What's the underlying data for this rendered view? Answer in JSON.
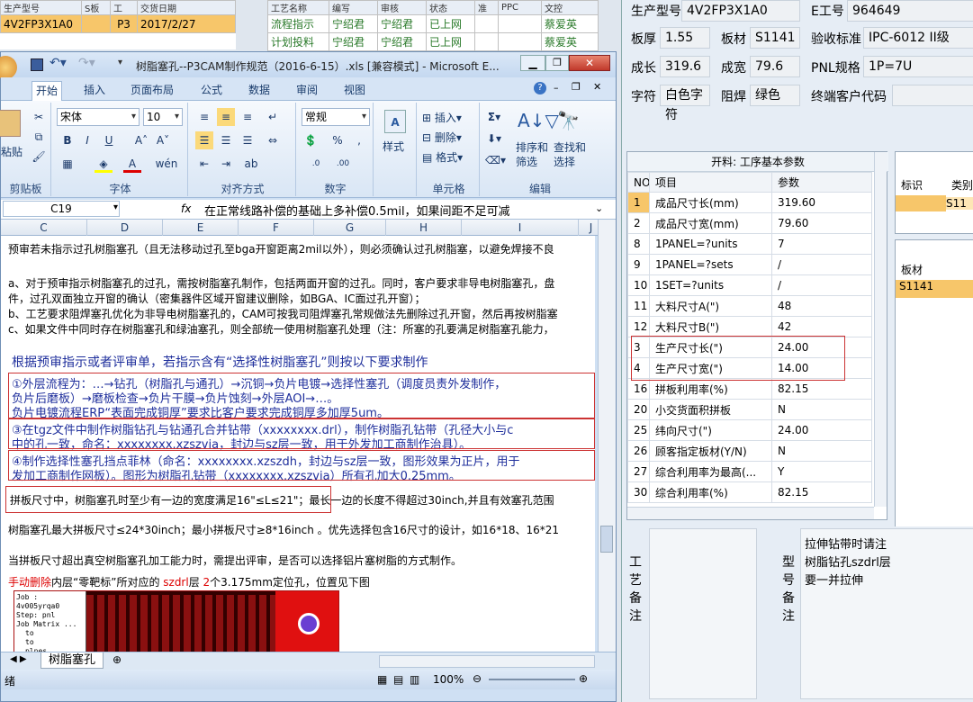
{
  "top_left_grid": {
    "headers": [
      "生产型号",
      "S板",
      "工",
      "交货日期"
    ],
    "row": [
      "4V2FP3X1A0",
      "",
      "P3",
      "2017/2/27"
    ]
  },
  "top_mid_grid": {
    "headers": [
      "工艺名称",
      "编写",
      "审核",
      "状态",
      "准",
      "PPC",
      "文控"
    ],
    "rows": [
      [
        "流程指示",
        "宁绍君",
        "宁绍君",
        "已上网",
        "",
        "",
        "蔡爱英"
      ],
      [
        "计划投料",
        "宁绍君",
        "宁绍君",
        "已上网",
        "",
        "",
        "蔡爱英"
      ]
    ]
  },
  "excel": {
    "title": "树脂塞孔--P3CAM制作规范（2016-6-15）.xls  [兼容模式] - Microsoft E...",
    "tabs": [
      "开始",
      "插入",
      "页面布局",
      "公式",
      "数据",
      "审阅",
      "视图"
    ],
    "groups": {
      "clipboard": "剪贴板",
      "font": "字体",
      "align": "对齐方式",
      "number": "数字",
      "cells": "单元格",
      "edit": "编辑",
      "styles": "样式"
    },
    "paste": "粘贴",
    "font_name": "宋体",
    "font_size": "10",
    "num_format": "常规",
    "cells_btns": [
      "插入",
      "删除",
      "格式"
    ],
    "sort": "排序和筛选",
    "find": "查找和选择",
    "style_btn": "样式",
    "name_box": "C19",
    "fx": "fx",
    "formula": "在正常线路补偿的基础上多补偿0.5mil，如果间距不足可减",
    "cols": [
      "C",
      "D",
      "E",
      "F",
      "G",
      "H",
      "I",
      "J"
    ],
    "lines": [
      "预审若未指示过孔树脂塞孔（且无法移动过孔至bga开窗距离2mil以外），则必须确认过孔树脂塞，以避免焊接不良",
      "a、对于预审指示树脂塞孔的过孔，需按树脂塞孔制作，包括两面开窗的过孔。同时，客户要求非导电树脂塞孔，盘",
      "件，过孔双面独立开窗的确认（密集器件区域开窗建议删除，如BGA、IC面过孔开窗）；",
      "b、工艺要求阻焊塞孔优化为非导电树脂塞孔的，CAM可按我司阻焊塞孔常规做法先删除过孔开窗，然后再按树脂塞",
      "c、如果文件中同时存在树脂塞孔和绿油塞孔，则全部统一使用树脂塞孔处理（注：所塞的孔要满足树脂塞孔能力，",
      "根据预审指示或者评审单，若指示含有“选择性树脂塞孔”则按以下要求制作",
      "①外层流程为：…→钻孔（树脂孔与通孔）→沉铜→负片电镀→选择性塞孔（调度员责外发制作，",
      "负片后磨板）→磨板检查→负片干膜→负片蚀刻→外层AOI→…。",
      "负片电镀流程ERP“表面完成铜厚”要求比客户要求完成铜厚多加厚5um。",
      "③在tgz文件中制作树脂钻孔与钻通孔合并钻带（xxxxxxxx.drl），制作树脂孔钻带（孔径大小与c",
      "中的孔一致，命名：xxxxxxxx.xzszvia，封边与sz层一致，用于外发加工商制作治具）。",
      "④制作选择性塞孔挡点菲林（命名：xxxxxxxx.xzszdh，封边与sz层一致，图形效果为正片，用于",
      "发加工商制作网板）。图形为树脂孔钻带（xxxxxxxx.xzszvia）所有孔加大0.25mm。",
      "拼板尺寸中，树脂塞孔时至少有一边的宽度满足16\"≤L≤21\"；最长一边的长度不得超过30inch,并且有效塞孔范围",
      "树脂塞孔最大拼板尺寸≤24*30inch；最小拼板尺寸≥8*16inch 。优先选择包含16尺寸的设计，如16*18、16*21",
      "当拼板尺寸超出真空树脂塞孔加工能力时，需提出评审，是否可以选择铝片塞树脂的方式制作。"
    ],
    "last_line": {
      "p1": "手动删除",
      "p2": "内层“零靶标”所对应的 ",
      "p3": "szdrl",
      "p4": "层 ",
      "p5": "2",
      "p6": "个3.175mm定位孔，位置见下图"
    },
    "mini": [
      "Job : 4v005yrqa0",
      "Step: pnl",
      "Job Matrix ...",
      "to",
      "to",
      "plnes"
    ],
    "sheet_tab": "树脂塞孔",
    "status": "绪",
    "zoom": "100%"
  },
  "right": {
    "model_label": "生产型号",
    "model": "4V2FP3X1A0",
    "eno_label": "E工号",
    "eno": "964649",
    "thick_label": "板厚",
    "thick": "1.55",
    "mat_label": "板材",
    "mat": "S1141",
    "std_label": "验收标准",
    "std": "IPC-6012 II级",
    "len_label": "成长",
    "len": "319.6",
    "wid_label": "成宽",
    "wid": "79.6",
    "pnl_label": "PNL规格",
    "pnl": "1P=7U",
    "char_label": "字符",
    "char": "白色字符",
    "mask_label": "阻焊",
    "mask": "绿色",
    "cust_label": "终端客户代码",
    "grid_title": "开料: 工序基本参数",
    "grid_headers": [
      "NO",
      "项目",
      "参数"
    ],
    "grid_rows": [
      [
        "1",
        "成品尺寸长(mm)",
        "319.60"
      ],
      [
        "2",
        "成品尺寸宽(mm)",
        "79.60"
      ],
      [
        "8",
        "1PANEL=?units",
        "7"
      ],
      [
        "9",
        "1PANEL=?sets",
        "/"
      ],
      [
        "10",
        "1SET=?units",
        "/"
      ],
      [
        "11",
        "大料尺寸A(\")",
        "48"
      ],
      [
        "12",
        "大料尺寸B(\")",
        "42"
      ],
      [
        "3",
        "生产尺寸长(\")",
        "24.00"
      ],
      [
        "4",
        "生产尺寸宽(\")",
        "14.00"
      ],
      [
        "16",
        "拼板利用率(%)",
        "82.15"
      ],
      [
        "20",
        "小交货面积拼板",
        "N"
      ],
      [
        "25",
        "纬向尺寸(\")",
        "24.00"
      ],
      [
        "26",
        "顾客指定板材(Y/N)",
        "N"
      ],
      [
        "27",
        "综合利用率为最高(...",
        "Y"
      ],
      [
        "30",
        "综合利用率(%)",
        "82.15"
      ]
    ],
    "side1_headers": [
      "标识",
      "类别"
    ],
    "side1_val": "S11",
    "side2_header": "板材",
    "side2_val": "S1141",
    "note_left": "工艺备注",
    "note_mid": "型号备注",
    "note_text": [
      "拉伸钻带时请注",
      "树脂钻孔szdrl层",
      "要一并拉伸"
    ]
  }
}
